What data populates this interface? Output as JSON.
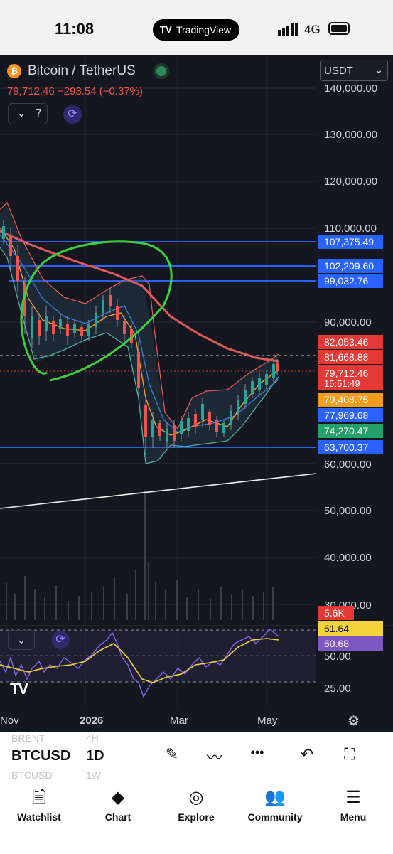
{
  "status_bar": {
    "time": "11:08",
    "pill_label": "TradingView",
    "network": "4G"
  },
  "chart_header": {
    "symbol_name": "Bitcoin / TetherUS",
    "last_price": "79,712.46",
    "change": "−293.54 (−0.37%)",
    "indicator_count": "7",
    "currency_select": "USDT"
  },
  "price_axis": {
    "labels": [
      "140,000.00",
      "130,000.00",
      "120,000.00",
      "110,000.00",
      "90,000.00",
      "60,000.00",
      "50,000.00",
      "40,000.00",
      "30,000.00"
    ],
    "scale": "log"
  },
  "price_tags": [
    {
      "label": "107,375.49",
      "color": "#2962ff"
    },
    {
      "label": "102,209.60",
      "color": "#2962ff"
    },
    {
      "label": "99,032.76",
      "color": "#2962ff"
    },
    {
      "label": "82,053.46",
      "color": "#e53935"
    },
    {
      "label": "81,668.88",
      "color": "#e53935"
    },
    {
      "label": "79,712.46",
      "color": "#e53935"
    },
    {
      "label": "15:51:49",
      "color": "#e53935"
    },
    {
      "label": "79,408.75",
      "color": "#f59c1a"
    },
    {
      "label": "77,969.68",
      "color": "#2962ff"
    },
    {
      "label": "74,270.47",
      "color": "#26a069"
    },
    {
      "label": "63,700.37",
      "color": "#2962ff"
    }
  ],
  "volume_tag": {
    "label": "5.6K",
    "color": "#e53935"
  },
  "rsi": {
    "axis_labels": [
      "50.00",
      "25.00"
    ],
    "value_tags": [
      {
        "label": "61.64",
        "color": "#f5d33a"
      },
      {
        "label": "60.68",
        "color": "#7e57c2"
      }
    ]
  },
  "time_axis": {
    "labels": [
      "Nov",
      "2026",
      "Mar",
      "May"
    ]
  },
  "toolbar": {
    "symbol": "BTCUSD",
    "symbol_ghost_above": "BRENT",
    "symbol_ghost_below": "BTCUSD",
    "interval": "1D",
    "interval_ghost_above": "4H",
    "interval_ghost_below": "1W"
  },
  "tabbar": {
    "items": [
      {
        "label": "Watchlist",
        "icon": "bookmark-icon"
      },
      {
        "label": "Chart",
        "icon": "chart-icon"
      },
      {
        "label": "Explore",
        "icon": "compass-icon"
      },
      {
        "label": "Community",
        "icon": "people-icon"
      },
      {
        "label": "Menu",
        "icon": "hamburger-icon"
      }
    ]
  },
  "colors": {
    "background": "#14171f",
    "up": "#26a69a",
    "down": "#ef5350",
    "horizontal_levels": "#2962ff",
    "ma_200": "#e05a5a",
    "channel_highlight": "#3ecf3e"
  }
}
